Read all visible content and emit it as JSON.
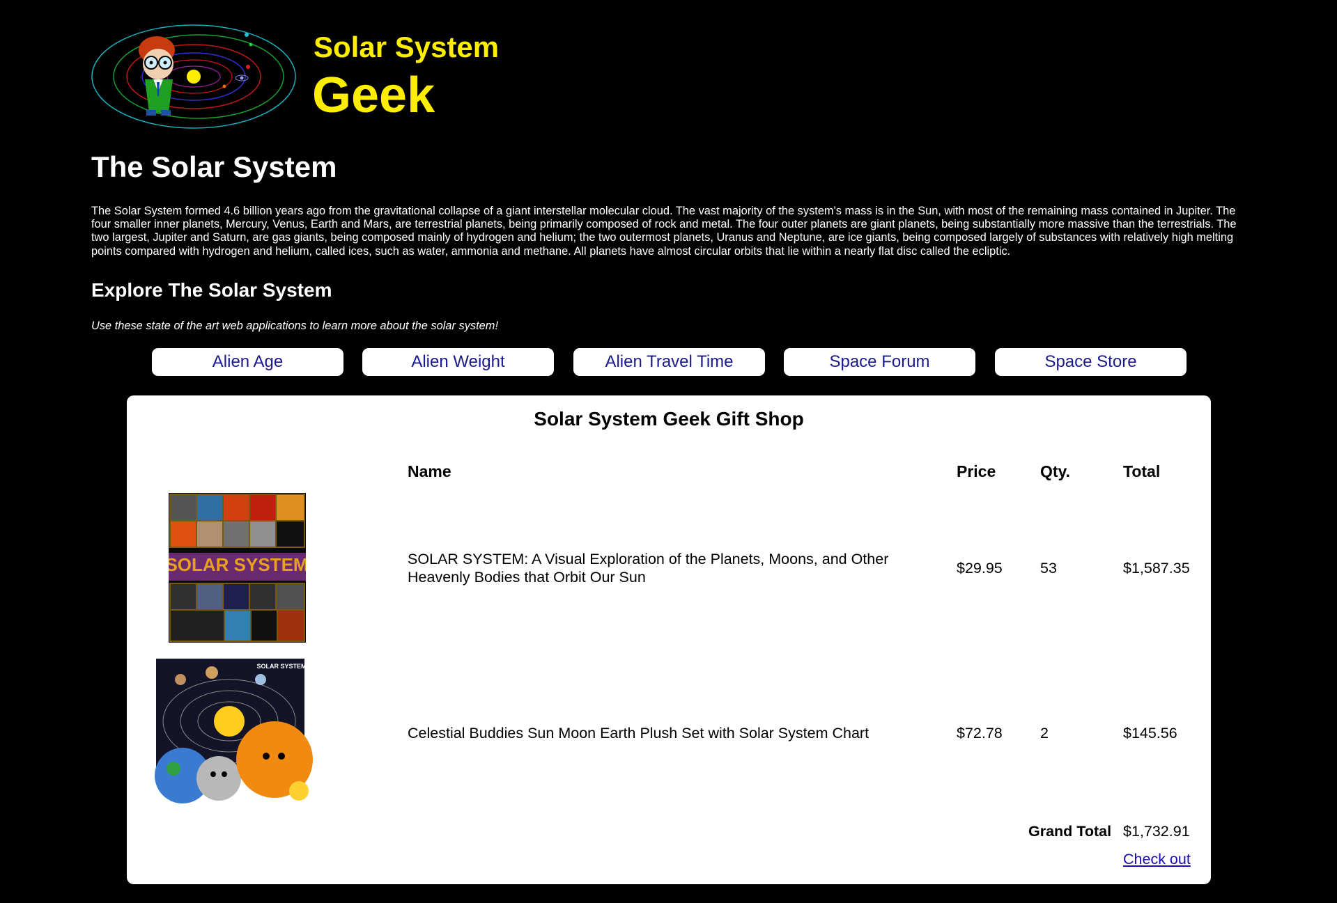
{
  "header": {
    "logo_line1": "Solar System",
    "logo_line2": "Geek"
  },
  "page_title": "The Solar System",
  "intro_text": "The Solar System formed 4.6 billion years ago from the gravitational collapse of a giant interstellar molecular cloud. The vast majority of the system's mass is in the Sun, with most of the remaining mass contained in Jupiter. The four smaller inner planets, Mercury, Venus, Earth and Mars, are terrestrial planets, being primarily composed of rock and metal. The four outer planets are giant planets, being substantially more massive than the terrestrials. The two largest, Jupiter and Saturn, are gas giants, being composed mainly of hydrogen and helium; the two outermost planets, Uranus and Neptune, are ice giants, being composed largely of substances with relatively high melting points compared with hydrogen and helium, called ices, such as water, ammonia and methane. All planets have almost circular orbits that lie within a nearly flat disc called the ecliptic.",
  "explore": {
    "title": "Explore The Solar System",
    "subtitle": "Use these state of the art web applications to learn more about the solar system!"
  },
  "nav": [
    {
      "label": "Alien Age"
    },
    {
      "label": "Alien Weight"
    },
    {
      "label": "Alien Travel Time"
    },
    {
      "label": "Space Forum"
    },
    {
      "label": "Space Store"
    }
  ],
  "shop": {
    "title": "Solar System Geek Gift Shop",
    "columns": {
      "name": "Name",
      "price": "Price",
      "qty": "Qty.",
      "total": "Total"
    },
    "items": [
      {
        "name_line1": "SOLAR SYSTEM: A Visual Exploration of the Planets, Moons, and Other",
        "name_line2": "Heavenly Bodies that Orbit Our Sun",
        "price": "$29.95",
        "qty": "53",
        "total": "$1,587.35"
      },
      {
        "name": "Celestial Buddies Sun Moon Earth Plush Set with Solar System Chart",
        "price": "$72.78",
        "qty": "2",
        "total": "$145.56"
      }
    ],
    "grand_total_label": "Grand Total",
    "grand_total_value": "$1,732.91",
    "checkout_label": "Check out"
  },
  "colors": {
    "background": "#000000",
    "logo_yellow": "#ffee00",
    "nav_text": "#1a1a8c",
    "link": "#1a0dab"
  }
}
